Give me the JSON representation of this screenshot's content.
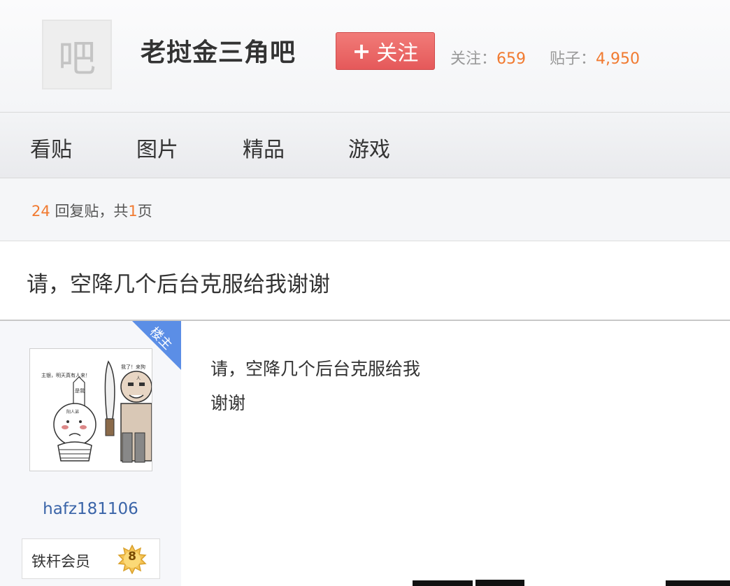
{
  "header": {
    "logo_text": "吧",
    "forum_name": "老挝金三角吧",
    "follow_button": {
      "icon": "plus-icon",
      "label": "关注"
    },
    "stats": {
      "follow_label": "关注：",
      "follow_count": "659",
      "posts_label": "贴子：",
      "posts_count": "4,950"
    }
  },
  "nav": {
    "tabs": [
      {
        "label": "看贴"
      },
      {
        "label": "图片"
      },
      {
        "label": "精品"
      },
      {
        "label": "游戏"
      }
    ]
  },
  "summary": {
    "reply_count": "24",
    "reply_text": " 回复贴，共",
    "page_count": "1",
    "page_unit": "页"
  },
  "thread": {
    "title": "请，空降几个后台克服给我谢谢"
  },
  "post": {
    "op_badge": "楼主",
    "author": {
      "username": "hafz181106",
      "member_title": "铁杆会员",
      "level": "8",
      "avatar_caption_left": "主银，明天真有人来！",
      "avatar_caption_right": "我了！来狗",
      "avatar_sign_text": "是我",
      "avatar_body_text": "阳人弟"
    },
    "content_lines": [
      "请，空降几个后台克服给我",
      "谢谢"
    ]
  },
  "colors": {
    "accent_orange": "#f17a30",
    "follow_button_red": "#e5595a",
    "link_blue": "#3a64a8",
    "op_corner_blue": "#5b8ee6"
  }
}
